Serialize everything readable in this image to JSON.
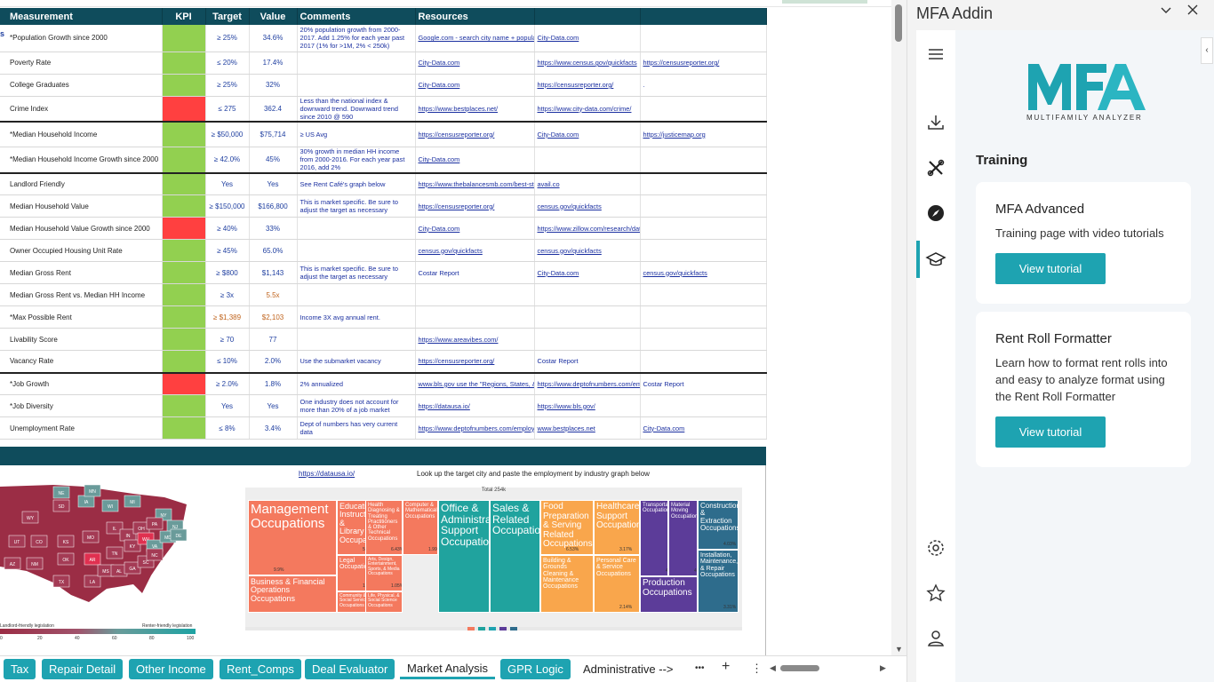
{
  "sheet": {
    "headers": {
      "measurement": "Measurement",
      "kpi": "KPI",
      "target": "Target",
      "value": "Value",
      "comments": "Comments",
      "resources": "Resources"
    },
    "row_marker": "s",
    "rows": [
      {
        "measurement": "*Population Growth since 2000",
        "kpi": "green",
        "target": "≥ 25%",
        "value": "34.6%",
        "comment": "20% population growth from 2000-2017.  Add 1.25% for each year past 2017 (1% for >1M, 2% < 250k)",
        "res1": "Google.com - search city name + population",
        "res2": "City-Data.com",
        "res3": ""
      },
      {
        "measurement": "Poverty Rate",
        "kpi": "green",
        "target": "≤ 20%",
        "value": "17.4%",
        "comment": "",
        "res1": "City-Data.com",
        "res2": "https://www.census.gov/quickfacts",
        "res3": "https://censusreporter.org/"
      },
      {
        "measurement": "College Graduates",
        "kpi": "green",
        "target": "≥ 25%",
        "value": "32%",
        "comment": "",
        "res1": "City-Data.com",
        "res2": "https://censusreporter.org/",
        "res3": "."
      },
      {
        "measurement": "Crime Index",
        "kpi": "red",
        "target": "≤ 275",
        "value": "362.4",
        "comment": "Less than the national index & downward trend. Downward trend since 2010 @ 590",
        "res1": "https://www.bestplaces.net/",
        "res2": "https://www.city-data.com/crime/",
        "res3": ""
      },
      {
        "measurement": "*Median Household Income",
        "kpi": "green",
        "target": "≥ $50,000",
        "value": "$75,714",
        "comment": "≥ US Avg",
        "res1": "https://censusreporter.org/",
        "res2": "City-Data.com",
        "res3": "https://justicemap.org"
      },
      {
        "measurement": "*Median Household Income Growth since 2000",
        "kpi": "green",
        "target": "≥ 42.0%",
        "value": "45%",
        "comment": "30% growth in median HH income from 2000-2016. For each year past 2016, add 2%",
        "res1": "City-Data.com",
        "res2": "",
        "res3": ""
      },
      {
        "measurement": "Landlord Friendly",
        "kpi": "green",
        "target": "Yes",
        "value": "Yes",
        "comment": "See Rent Café's graph below",
        "res1": "https://www.thebalancesmb.com/best-states",
        "res2": "avail.co",
        "res3": ""
      },
      {
        "measurement": "Median Household Value",
        "kpi": "green",
        "target": "≥ $150,000",
        "value": "$166,800",
        "comment": "This is market specific.  Be sure to adjust the target as necessary",
        "res1": "https://censusreporter.org/",
        "res2": "census.gov/quickfacts",
        "res3": ""
      },
      {
        "measurement": "Median Household Value Growth since 2000",
        "kpi": "red",
        "target": "≥ 40%",
        "value": "33%",
        "comment": "",
        "res1": "City-Data.com",
        "res2": "https://www.zillow.com/research/data/",
        "res3": ""
      },
      {
        "measurement": "Owner Occupied Housing Unit Rate",
        "kpi": "green",
        "target": "≥ 45%",
        "value": "65.0%",
        "comment": "",
        "res1": "census.gov/quickfacts",
        "res2": "census.gov/quickfacts",
        "res3": ""
      },
      {
        "measurement": "Median Gross Rent",
        "kpi": "green",
        "target": "≥ $800",
        "value": "$1,143",
        "comment": "This is market specific.  Be sure to adjust the target as necessary",
        "res1": "Costar Report",
        "res2": "City-Data.com",
        "res3": "census.gov/quickfacts"
      },
      {
        "measurement": "Median Gross Rent vs. Median HH Income",
        "kpi": "green",
        "target": "≥ 3x",
        "value": "5.5x",
        "comment": "",
        "res1": "",
        "res2": "",
        "res3": ""
      },
      {
        "measurement": "*Max Possible Rent",
        "kpi": "green",
        "target": "≥ $1,389",
        "value": "$2,103",
        "comment": "Income 3X avg annual rent.",
        "res1": "",
        "res2": "",
        "res3": ""
      },
      {
        "measurement": "Livability Score",
        "kpi": "green",
        "target": "≥ 70",
        "value": "77",
        "comment": "",
        "res1": "https://www.areavibes.com/",
        "res2": "",
        "res3": ""
      },
      {
        "measurement": "Vacancy Rate",
        "kpi": "green",
        "target": "≤ 10%",
        "value": "2.0%",
        "comment": "Use the submarket vacancy",
        "res1": "https://censusreporter.org/",
        "res2": "Costar Report",
        "res3": ""
      },
      {
        "measurement": "*Job Growth",
        "kpi": "red",
        "target": "≥ 2.0%",
        "value": "1.8%",
        "comment": "2% annualized",
        "res1": "www.bls.gov  use the \"Regions, States, & Areas at a Glance\" feature",
        "res2": "https://www.deptofnumbers.com/employment",
        "res3": "Costar Report"
      },
      {
        "measurement": "*Job Diversity",
        "kpi": "green",
        "target": "Yes",
        "value": "Yes",
        "comment": "One industry does not account for more than 20% of a job market",
        "res1": "https://datausa.io/",
        "res2": "https://www.bls.gov/",
        "res3": ""
      },
      {
        "measurement": "Unemployment Rate",
        "kpi": "green",
        "target": "≤ 8%",
        "value": "3.4%",
        "comment": "Dept of numbers has very current data",
        "res1": "https://www.deptofnumbers.com/employment",
        "res2": "www.bestplaces.net",
        "res3": "City-Data.com"
      }
    ],
    "datausa_link": "https://datausa.io/",
    "datausa_note": "Look up the target city and paste the employment by industry graph below",
    "map": {
      "legend_left": "Landlord-friendly legislation",
      "legend_right": "Renter-friendly legislation",
      "ticks": [
        "0",
        "20",
        "40",
        "60",
        "80",
        "100"
      ],
      "states": [
        "NE",
        "IA",
        "WY",
        "SD",
        "MN",
        "WI",
        "MI",
        "NY",
        "UT",
        "CO",
        "KS",
        "MO",
        "IL",
        "IN",
        "OH",
        "PA",
        "NJ",
        "AZ",
        "NM",
        "OK",
        "AR",
        "TN",
        "KY",
        "WV",
        "VA",
        "MD",
        "DE",
        "TX",
        "LA",
        "MS",
        "AL",
        "GA",
        "SC",
        "NC"
      ]
    },
    "treemap": {
      "total": "Total 254k",
      "cells": [
        {
          "label": "Management Occupations",
          "pct": "9.9%",
          "color": "#f4795e"
        },
        {
          "label": "Business & Financial Operations Occupations",
          "pct": "",
          "color": "#f4795e"
        },
        {
          "label": "Education Instruction, & Library Occupations",
          "pct": "5%",
          "color": "#f4795e"
        },
        {
          "label": "Legal Occupations",
          "pct": "1.02%",
          "color": "#f4795e"
        },
        {
          "label": "Community & Social Service Occupations",
          "pct": "",
          "color": "#f4795e"
        },
        {
          "label": "Health Diagnosing & Treating Practitioners & Other Technical Occupations",
          "pct": "6.43%",
          "color": "#f4795e"
        },
        {
          "label": "Arts, Design, Entertainment, Sports, & Media Occupations",
          "pct": "1.05%",
          "color": "#f4795e"
        },
        {
          "label": "Life, Physical, & Social Science Occupations",
          "pct": "",
          "color": "#f4795e"
        },
        {
          "label": "Computer & Mathematical Occupations",
          "pct": "1.99%",
          "color": "#f4795e"
        },
        {
          "label": "Office & Administrative Support Occupations",
          "pct": "",
          "color": "#20a39e"
        },
        {
          "label": "Sales & Related Occupations",
          "pct": "",
          "color": "#20a39e"
        },
        {
          "label": "Food Preparation & Serving Related Occupations",
          "pct": "6.53%",
          "color": "#f9a64c"
        },
        {
          "label": "Building & Grounds Cleaning & Maintenance Occupations",
          "pct": "",
          "color": "#f9a64c"
        },
        {
          "label": "Healthcare Support Occupations",
          "pct": "3.17%",
          "color": "#f9a64c"
        },
        {
          "label": "Personal Care & Service Occupations",
          "pct": "2.14%",
          "color": "#f9a64c"
        },
        {
          "label": "Transportation Occupations",
          "pct": "4.7%",
          "color": "#5c3c99"
        },
        {
          "label": "Material Moving Occupations",
          "pct": "4.3%",
          "color": "#5c3c99"
        },
        {
          "label": "Production Occupations",
          "pct": "",
          "color": "#5c3c99"
        },
        {
          "label": "Construction & Extraction Occupations",
          "pct": "4.03%",
          "color": "#2e6c8c"
        },
        {
          "label": "Installation, Maintenance, & Repair Occupations",
          "pct": "3.31%",
          "color": "#2e6c8c"
        }
      ]
    }
  },
  "tabs": [
    "Tax",
    "Repair Detail",
    "Other Income",
    "Rent_Comps",
    "Deal Evaluator",
    "Market Analysis",
    "GPR Logic",
    "Administrative -->"
  ],
  "tab_controls": {
    "more": "•••",
    "add": "+",
    "menu": "⋮"
  },
  "pane": {
    "title": "MFA Addin",
    "logo_text": "MULTIFAMILY ANALYZER",
    "section_title": "Training",
    "cards": [
      {
        "title": "MFA Advanced",
        "desc": "Training page with video tutorials",
        "button": "View tutorial"
      },
      {
        "title": "Rent Roll Formatter",
        "desc": "Learn how to format rent rolls into and easy to analyze format using the Rent Roll Formatter",
        "button": "View tutorial"
      }
    ],
    "rail_icons": [
      "menu-icon",
      "download-icon",
      "tools-icon",
      "compass-icon",
      "graduation-cap-icon",
      "gear-icon",
      "star-icon",
      "user-icon"
    ],
    "accent_color": "#1ea3b1"
  }
}
